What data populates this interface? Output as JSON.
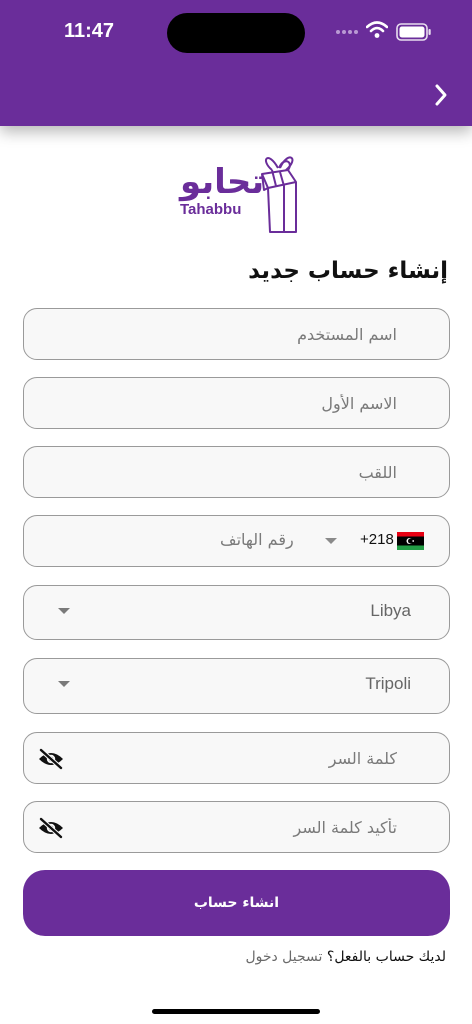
{
  "status_bar": {
    "time": "11:47"
  },
  "brand": {
    "name_ar": "تحابو",
    "name_en": "Tahabbu",
    "color": "#6a2d9a"
  },
  "form": {
    "title": "إنشاء حساب جديد",
    "username_placeholder": "اسم المستخدم",
    "first_name_placeholder": "الاسم الأول",
    "last_name_placeholder": "اللقب",
    "phone": {
      "dial_code": "+218",
      "placeholder": "رقم الهاتف",
      "country_flag": "libya-flag-icon"
    },
    "country_value": "Libya",
    "city_value": "Tripoli",
    "password_placeholder": "كلمة السر",
    "confirm_password_placeholder": "تأكيد كلمة السر",
    "submit_label": "انشاء حساب"
  },
  "login_prompt": {
    "text": "لديك حساب بالفعل؟",
    "link": "تسجيل دخول"
  }
}
